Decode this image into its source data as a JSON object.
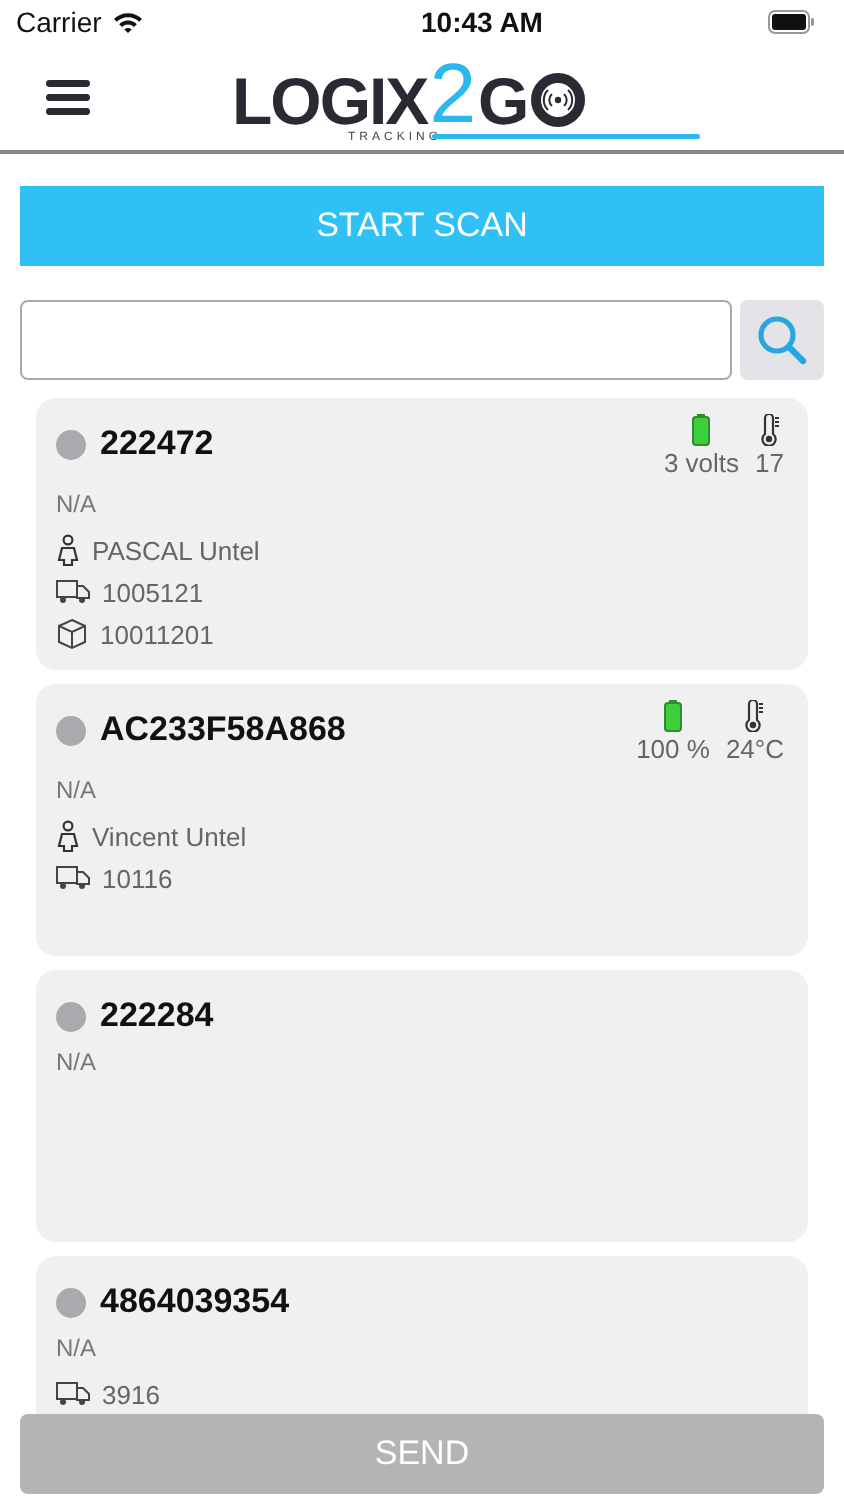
{
  "status_bar": {
    "carrier": "Carrier",
    "time": "10:43 AM"
  },
  "logo": {
    "left": "LOGIX",
    "digit": "2",
    "right": "G",
    "tagline": "TRACKING"
  },
  "start_button": "START SCAN",
  "devices": [
    {
      "id": "222472",
      "status": "N/A",
      "battery": {
        "level": 1,
        "reading": "3 volts"
      },
      "temperature": "17",
      "rows": [
        {
          "kind": "person",
          "text": "PASCAL Untel"
        },
        {
          "kind": "truck",
          "text": "1005121"
        },
        {
          "kind": "box",
          "text": "10011201"
        }
      ]
    },
    {
      "id": "AC233F58A868",
      "status": "N/A",
      "battery": {
        "level": 1,
        "reading": "100 %"
      },
      "temperature": "24°C",
      "rows": [
        {
          "kind": "person",
          "text": "Vincent Untel"
        },
        {
          "kind": "truck",
          "text": "10116"
        }
      ]
    },
    {
      "id": "222284",
      "status": "N/A"
    },
    {
      "id": "4864039354",
      "status": "N/A",
      "rows": [
        {
          "kind": "truck",
          "text": "3916"
        }
      ]
    }
  ],
  "send_button": {
    "label": "SEND",
    "disabled": true
  }
}
